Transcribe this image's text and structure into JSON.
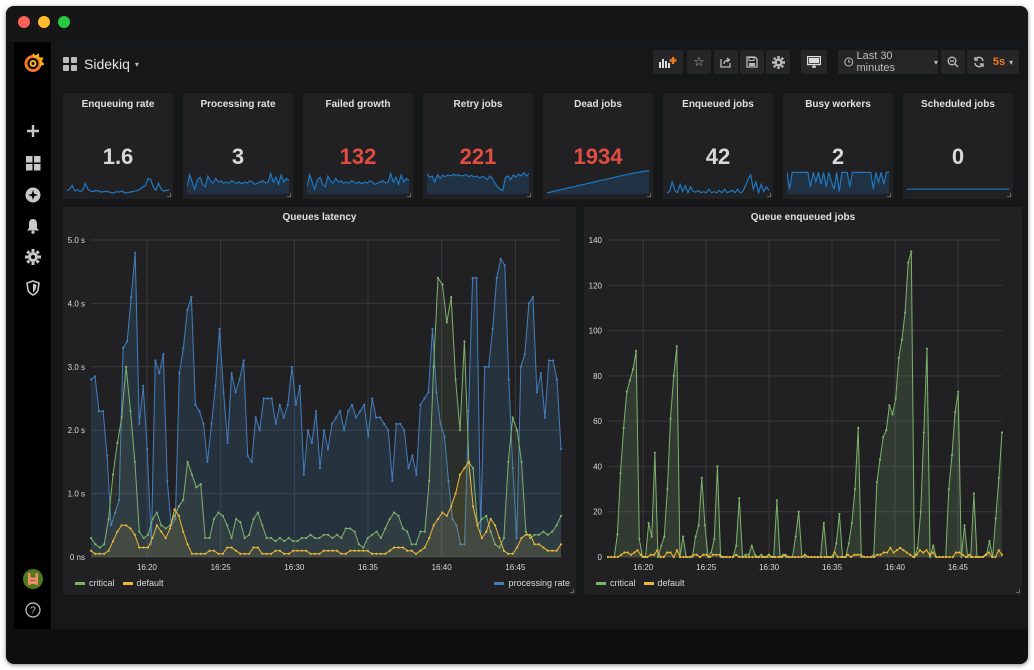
{
  "window": {
    "title": "Sidekiq"
  },
  "dashboard": {
    "title": "Sidekiq",
    "caret": "▾"
  },
  "toolbar": {
    "add_panel_icon": "add-panel",
    "star_icon": "☆",
    "share_icon": "share",
    "save_icon": "save",
    "settings_icon": "gear",
    "tv_icon": "monitor",
    "time_range": "Last 30 minutes",
    "time_caret": "▾",
    "zoom_out_icon": "zoom-out",
    "refresh_icon": "refresh",
    "refresh_interval": "5s",
    "refresh_caret": "▾",
    "accent_color": "#eb7b18"
  },
  "sidebar": {
    "items": [
      {
        "name": "create",
        "icon": "+"
      },
      {
        "name": "dashboards",
        "icon": "grid"
      },
      {
        "name": "explore",
        "icon": "compass"
      },
      {
        "name": "alerting",
        "icon": "bell"
      },
      {
        "name": "configuration",
        "icon": "gear"
      },
      {
        "name": "server-admin",
        "icon": "shield"
      }
    ],
    "help_icon": "?"
  },
  "stats": [
    {
      "title": "Enqueuing rate",
      "value": "1.6",
      "color": "#d8d9da",
      "spark": [
        0.15,
        0.2,
        0.35,
        0.12,
        0.18,
        0.1,
        0.15,
        0.45,
        0.2,
        0.12,
        0.1,
        0.15,
        0.12,
        0.08,
        0.1,
        0.12,
        0.08,
        0.06,
        0.05,
        0.1,
        0.08,
        0.12,
        0.06,
        0.05,
        0.08,
        0.1,
        0.12,
        0.15,
        0.2,
        0.3,
        0.35,
        0.65,
        0.6,
        0.3,
        0.15,
        0.45,
        0.2,
        0.12,
        0.15,
        0.18
      ],
      "fill": false
    },
    {
      "title": "Processing rate",
      "value": "3",
      "color": "#d8d9da",
      "spark": [
        0.3,
        0.8,
        0.5,
        0.2,
        0.6,
        0.7,
        0.4,
        0.3,
        0.75,
        0.55,
        0.45,
        0.65,
        0.5,
        0.55,
        0.45,
        0.5,
        0.45,
        0.55,
        0.5,
        0.45,
        0.5,
        0.42,
        0.5,
        0.45,
        0.55,
        0.5,
        0.4,
        0.45,
        0.5,
        0.55,
        0.45,
        0.5,
        0.85,
        0.5,
        0.7,
        0.4,
        0.8,
        0.5,
        0.65,
        0.55
      ],
      "fill": true
    },
    {
      "title": "Failed growth",
      "value": "132",
      "color": "#e24d42",
      "spark": [
        0.3,
        0.8,
        0.5,
        0.2,
        0.6,
        0.7,
        0.4,
        0.3,
        0.75,
        0.55,
        0.45,
        0.65,
        0.5,
        0.55,
        0.45,
        0.5,
        0.45,
        0.55,
        0.5,
        0.45,
        0.5,
        0.42,
        0.5,
        0.45,
        0.55,
        0.5,
        0.4,
        0.45,
        0.5,
        0.55,
        0.45,
        0.5,
        0.85,
        0.5,
        0.7,
        0.4,
        0.8,
        0.5,
        0.65,
        0.55
      ],
      "fill": true
    },
    {
      "title": "Retry jobs",
      "value": "221",
      "color": "#e24d42",
      "spark": [
        0.85,
        0.7,
        0.75,
        0.5,
        0.8,
        0.65,
        0.78,
        0.72,
        0.8,
        0.75,
        0.82,
        0.78,
        0.8,
        0.75,
        0.78,
        0.8,
        0.72,
        0.78,
        0.7,
        0.75,
        0.68,
        0.72,
        0.7,
        0.6,
        0.75,
        0.65,
        0.45,
        0.3,
        0.2,
        0.15,
        0.7,
        0.75,
        0.6,
        0.8,
        0.7,
        0.82,
        0.75,
        0.9,
        0.75,
        0.85
      ],
      "fill": true
    },
    {
      "title": "Dead jobs",
      "value": "1934",
      "color": "#e24d42",
      "spark": [
        0.05,
        0.07,
        0.1,
        0.12,
        0.15,
        0.17,
        0.2,
        0.22,
        0.25,
        0.27,
        0.3,
        0.32,
        0.35,
        0.37,
        0.4,
        0.42,
        0.45,
        0.47,
        0.5,
        0.52,
        0.55,
        0.57,
        0.6,
        0.62,
        0.65,
        0.67,
        0.7,
        0.72,
        0.75,
        0.77,
        0.8,
        0.82,
        0.85,
        0.87,
        0.88,
        0.9,
        0.92,
        0.94,
        0.96,
        0.98
      ],
      "fill": true
    },
    {
      "title": "Enqueued jobs",
      "value": "42",
      "color": "#d8d9da",
      "spark": [
        0.05,
        0.1,
        0.5,
        0.15,
        0.05,
        0.4,
        0.1,
        0.35,
        0.05,
        0.3,
        0.1,
        0.08,
        0.15,
        0.05,
        0.1,
        0.05,
        0.2,
        0.05,
        0.1,
        0.05,
        0.15,
        0.05,
        0.2,
        0.05,
        0.1,
        0.15,
        0.05,
        0.2,
        0.05,
        0.1,
        0.35,
        0.6,
        0.8,
        0.2,
        0.5,
        0.05,
        0.4,
        0.1,
        0.3,
        0.15
      ],
      "fill": false
    },
    {
      "title": "Busy workers",
      "value": "2",
      "color": "#d8d9da",
      "spark": [
        0.9,
        0.2,
        0.9,
        0.9,
        0.9,
        0.9,
        0.9,
        0.9,
        0.9,
        0.3,
        0.9,
        0.5,
        0.9,
        0.4,
        0.9,
        0.3,
        0.9,
        0.5,
        0.2,
        0.9,
        0.1,
        0.9,
        0.9,
        0.9,
        0.3,
        0.9,
        0.9,
        0.9,
        0.9,
        0.9,
        0.9,
        0.9,
        0.9,
        0.2,
        0.9,
        0.5,
        0.9,
        0.4,
        0.9,
        0.9
      ],
      "fill": true
    },
    {
      "title": "Scheduled jobs",
      "value": "0",
      "color": "#d8d9da",
      "spark": [
        0.2,
        0.2,
        0.2,
        0.2,
        0.2,
        0.2,
        0.2,
        0.2,
        0.2,
        0.2,
        0.2,
        0.2,
        0.2,
        0.2,
        0.2,
        0.2,
        0.2,
        0.2,
        0.2,
        0.2
      ],
      "fill": false
    }
  ],
  "chart_data": [
    {
      "type": "line",
      "title": "Queues latency",
      "ylabel": "",
      "xlabel": "",
      "ylim": [
        0,
        5
      ],
      "yticks": [
        "0 ns",
        "1.0 s",
        "2.0 s",
        "3.0 s",
        "4.0 s",
        "5.0 s"
      ],
      "xticks": [
        "16:20",
        "16:25",
        "16:30",
        "16:35",
        "16:40",
        "16:45"
      ],
      "xrange_minutes": [
        16.2,
        48.1
      ],
      "xtick_minutes": [
        20,
        25,
        30,
        35,
        40,
        45
      ],
      "grid": true,
      "series": [
        {
          "name": "critical",
          "color": "#7eb26d",
          "legend": "left",
          "values": [
            0.3,
            0.2,
            0.15,
            0.2,
            0.6,
            1.3,
            1.8,
            2.2,
            3.0,
            2.3,
            1.5,
            0.4,
            0.3,
            0.35,
            0.6,
            0.7,
            0.5,
            0.45,
            0.5,
            0.65,
            0.8,
            0.9,
            1.5,
            1.3,
            1.1,
            1.15,
            0.3,
            0.3,
            0.6,
            0.7,
            0.65,
            0.5,
            0.3,
            0.6,
            0.55,
            0.3,
            0.35,
            0.6,
            0.7,
            0.5,
            0.3,
            0.3,
            0.25,
            0.3,
            0.25,
            0.3,
            0.25,
            0.25,
            0.3,
            0.3,
            0.35,
            0.3,
            0.3,
            0.35,
            0.35,
            0.3,
            0.35,
            0.3,
            0.45,
            0.45,
            0.4,
            0.2,
            0.15,
            0.3,
            0.35,
            0.4,
            0.3,
            0.45,
            0.6,
            0.7,
            0.65,
            0.45,
            0.4,
            0.2,
            0.2,
            0.4,
            0.4,
            1.2,
            3.0,
            4.4,
            4.3,
            3.7,
            4.1,
            2.8,
            2.0,
            3.4,
            1.5,
            1.4,
            0.5,
            0.6,
            0.65,
            0.4,
            0.2,
            0.15,
            0.3,
            1.5,
            2.2,
            2.0,
            1.5,
            0.4,
            0.3,
            0.35,
            0.35,
            0.4,
            0.35,
            0.4,
            0.5,
            0.65
          ]
        },
        {
          "name": "default",
          "color": "#eab839",
          "legend": "left",
          "values": [
            0.1,
            0.05,
            0.05,
            0.05,
            0.1,
            0.25,
            0.4,
            0.5,
            0.5,
            0.45,
            0.35,
            0.15,
            0.15,
            0.15,
            0.3,
            0.5,
            0.4,
            0.3,
            0.45,
            0.75,
            0.65,
            0.4,
            0.2,
            0.05,
            0.05,
            0.05,
            0.05,
            0.1,
            0.1,
            0.05,
            0.05,
            0.15,
            0.15,
            0.1,
            0.05,
            0.05,
            0.05,
            0.15,
            0.15,
            0.05,
            0.05,
            0.05,
            0.1,
            0.1,
            0.05,
            0.05,
            0.1,
            0.1,
            0.1,
            0.1,
            0.05,
            0.05,
            0.05,
            0.1,
            0.1,
            0.1,
            0.1,
            0.05,
            0.05,
            0.1,
            0.1,
            0.1,
            0.1,
            0.1,
            0.05,
            0.05,
            0.05,
            0.05,
            0.1,
            0.15,
            0.15,
            0.15,
            0.1,
            0.1,
            0.05,
            0.1,
            0.15,
            0.3,
            0.5,
            0.6,
            0.7,
            0.65,
            0.8,
            1.0,
            1.3,
            1.4,
            1.5,
            0.8,
            0.5,
            0.3,
            0.4,
            0.6,
            0.5,
            0.3,
            0.1,
            0.05,
            0.05,
            0.15,
            0.3,
            0.35,
            0.35,
            0.2,
            0.2,
            0.15,
            0.1,
            0.1,
            0.1,
            0.2
          ]
        },
        {
          "name": "processing rate",
          "color": "#447ebc",
          "legend": "right",
          "fill": true,
          "values": [
            2.8,
            2.85,
            2.3,
            2.3,
            1.6,
            0.5,
            0.7,
            0.9,
            3.3,
            3.4,
            4.1,
            4.8,
            2.1,
            2.7,
            1.7,
            0.2,
            3.1,
            2.9,
            3.2,
            1.2,
            0.5,
            0.6,
            2.9,
            3.3,
            3.9,
            4.1,
            2.4,
            2.3,
            2.1,
            1.5,
            2.1,
            2.7,
            3.6,
            2.6,
            1.8,
            2.9,
            2.6,
            2.8,
            3.1,
            1.6,
            1.5,
            2.2,
            2.0,
            2.5,
            2.5,
            2.5,
            2.1,
            2.4,
            2.2,
            2.4,
            3.0,
            2.4,
            2.7,
            1.3,
            2.0,
            1.8,
            2.3,
            1.4,
            2.0,
            1.7,
            2.1,
            2.2,
            2.3,
            2.0,
            2.3,
            2.4,
            2.2,
            2.3,
            2.4,
            1.9,
            2.5,
            2.2,
            2.2,
            2.1,
            2.0,
            1.2,
            2.1,
            2.1,
            2.0,
            1.4,
            1.6,
            1.3,
            2.4,
            2.5,
            2.6,
            3.6,
            2.6,
            2.1,
            1.9,
            1.2,
            0.6,
            0.5,
            0.2,
            0.2,
            2.3,
            4.4,
            4.4,
            0.4,
            3.0,
            3.0,
            3.6,
            4.4,
            4.7,
            4.6,
            2.8,
            1.4,
            0.3,
            3.0,
            3.2,
            4.0,
            4.1,
            2.6,
            2.9,
            2.2,
            3.1,
            3.1,
            2.8,
            1.7
          ]
        }
      ]
    },
    {
      "type": "line",
      "title": "Queue enqueued jobs",
      "ylim": [
        0,
        140
      ],
      "yticks": [
        "0",
        "20",
        "40",
        "60",
        "80",
        "100",
        "120",
        "140"
      ],
      "xticks": [
        "16:20",
        "16:25",
        "16:30",
        "16:35",
        "16:40",
        "16:45"
      ],
      "xrange_minutes": [
        17.2,
        48.5
      ],
      "xtick_minutes": [
        20,
        25,
        30,
        35,
        40,
        45
      ],
      "grid": true,
      "series": [
        {
          "name": "critical",
          "color": "#7eb26d",
          "legend": "left",
          "fill": true,
          "values": [
            0,
            0,
            0,
            10,
            37,
            57,
            73,
            78,
            83,
            91,
            8,
            0,
            0,
            15,
            9,
            46,
            0,
            5,
            9,
            30,
            61,
            80,
            93,
            0,
            9,
            0,
            0,
            0,
            9,
            14,
            35,
            14,
            0,
            2,
            8,
            40,
            0,
            0,
            0,
            0,
            0,
            5,
            26,
            0,
            1,
            1,
            5,
            1,
            0,
            1,
            0,
            0,
            0,
            0,
            25,
            0,
            1,
            0,
            0,
            0,
            9,
            20,
            0,
            0,
            0,
            0,
            0,
            0,
            0,
            15,
            0,
            0,
            0,
            6,
            19,
            0,
            0,
            6,
            15,
            30,
            57,
            0,
            0,
            0,
            0,
            1,
            33,
            43,
            53,
            56,
            67,
            63,
            70,
            88,
            96,
            108,
            130,
            135,
            0,
            4,
            20,
            55,
            92,
            0,
            5,
            0,
            0,
            0,
            0,
            30,
            45,
            64,
            73,
            0,
            14,
            0,
            0,
            28,
            0,
            0,
            0,
            1,
            7,
            0,
            17,
            35,
            55
          ]
        },
        {
          "name": "default",
          "color": "#eab839",
          "legend": "left",
          "values": [
            0,
            0,
            0,
            0,
            1,
            2,
            2,
            1,
            2,
            3,
            1,
            0,
            0,
            1,
            1,
            3,
            0,
            0,
            2,
            2,
            0,
            3,
            0,
            0,
            0,
            0,
            1,
            1,
            0,
            1,
            1,
            0,
            1,
            1,
            1,
            0,
            0,
            0,
            0,
            1,
            0,
            0,
            0,
            0,
            0,
            0,
            0,
            0,
            0,
            1,
            0,
            0,
            0,
            0,
            1,
            0,
            0,
            0,
            0,
            0,
            1,
            0,
            0,
            0,
            0,
            0,
            0,
            0,
            0,
            2,
            0,
            0,
            0,
            1,
            0,
            1,
            1,
            1,
            0,
            0,
            0,
            0,
            1,
            1,
            2,
            2,
            4,
            2,
            3,
            4,
            3,
            2,
            1,
            0,
            1,
            3,
            2,
            3,
            1,
            2,
            0,
            0,
            0,
            0,
            0,
            0,
            2,
            2,
            1,
            0,
            1,
            0,
            0,
            0,
            0,
            1,
            2,
            0,
            0,
            3,
            1
          ]
        }
      ]
    }
  ]
}
